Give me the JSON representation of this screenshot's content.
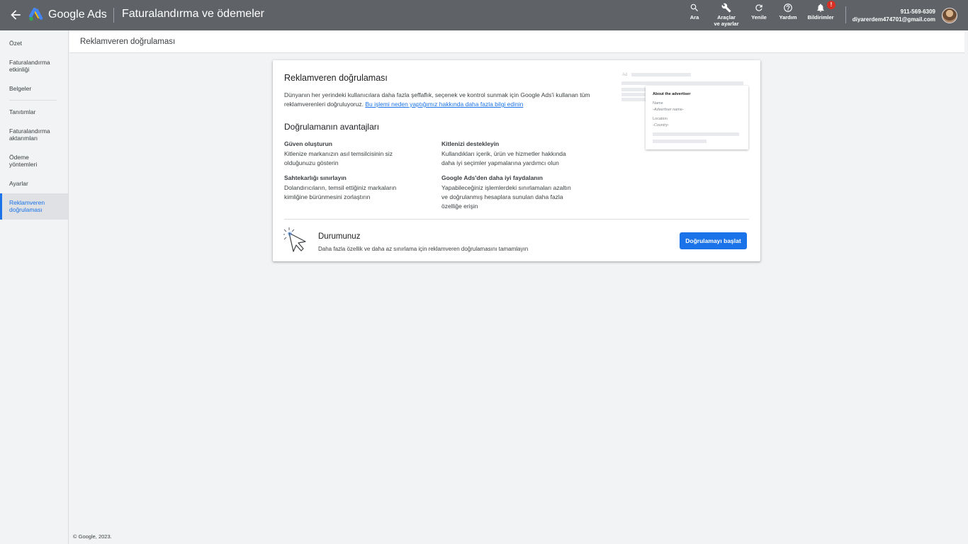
{
  "topbar": {
    "brand": "Google Ads",
    "page_name": "Faturalandırma ve ödemeler",
    "tools": {
      "search": "Ara",
      "tools_line1": "Araçlar",
      "tools_line2": "ve ayarlar",
      "refresh": "Yenile",
      "help": "Yardım",
      "notifications": "Bildirimler",
      "notifications_badge": "!"
    },
    "account": {
      "customer_id": "911-569-6309",
      "email": "diyarerdem474701@gmail.com"
    }
  },
  "sidebar": {
    "items": [
      {
        "label": "Özet"
      },
      {
        "label": "Faturalandırma etkinliği"
      },
      {
        "label": "Belgeler"
      },
      {
        "label": "Tanıtımlar"
      },
      {
        "label": "Faturalandırma aktarımları"
      },
      {
        "label": "Ödeme yöntemleri"
      },
      {
        "label": "Ayarlar"
      },
      {
        "label": "Reklamveren doğrulaması",
        "active": true
      }
    ]
  },
  "header": {
    "title": "Reklamveren doğrulaması"
  },
  "card": {
    "title": "Reklamveren doğrulaması",
    "intro_text": "Dünyanın her yerindeki kullanıcılara daha fazla şeffaflık, seçenek ve kontrol sunmak için Google Ads'i kullanan tüm reklamverenleri doğruluyoruz. ",
    "intro_link": "Bu işlemi neden yaptığımız hakkında daha fazla bilgi edinin",
    "benefits_title": "Doğrulamanın avantajları",
    "benefits": [
      {
        "heading": "Güven oluşturun",
        "text": "Kitlenize markanızın asıl temsilcisinin siz olduğunuzu gösterin"
      },
      {
        "heading": "Kitlenizi destekleyin",
        "text": "Kullandıkları içerik, ürün ve hizmetler hakkında daha iyi seçimler yapmalarına yardımcı olun"
      },
      {
        "heading": "Sahtekarlığı sınırlayın",
        "text": "Dolandırıcıların, temsil ettiğiniz markaların kimliğine bürünmesini zorlaştırın"
      },
      {
        "heading": "Google Ads'den daha iyi faydalanın",
        "text": "Yapabileceğiniz işlemlerdeki sınırlamaları azaltın ve doğrulanmış hesaplara sunulan daha fazla özelliğe erişin"
      }
    ],
    "status_title": "Durumunuz",
    "status_text": "Daha fazla özellik ve daha az sınırlama için reklamveren doğrulamasını tamamlayın",
    "start_button": "Doğrulamayı başlat",
    "illustration": {
      "ad_label": "Ad",
      "popup_heading": "About the advertiser",
      "name_label": "Name",
      "name_value": "-Advertiser name-",
      "location_label": "Location",
      "location_value": "-Country-"
    }
  },
  "footer": "© Google, 2023.",
  "colors": {
    "topbar": "#5f6368",
    "accent": "#1a73e8",
    "badge": "#d93025"
  }
}
